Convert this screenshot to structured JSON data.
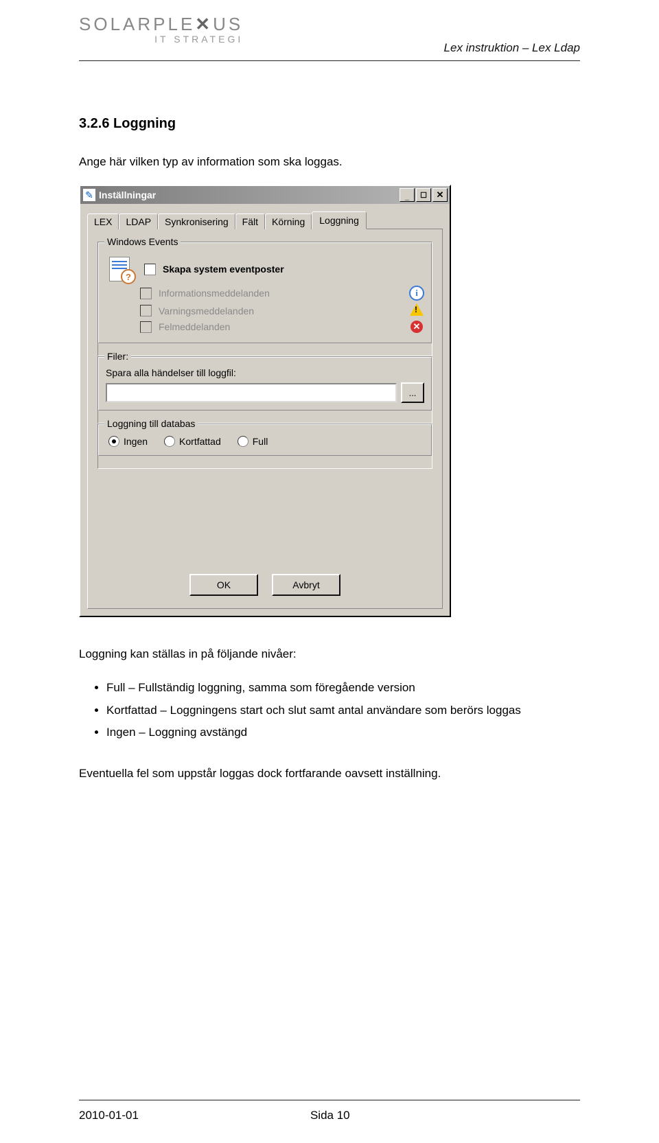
{
  "header": {
    "logo_main_a": "SOLARPLE",
    "logo_main_b": "US",
    "logo_sub": "IT STRATEGI",
    "doc_title": "Lex instruktion – Lex Ldap"
  },
  "section": {
    "heading": "3.2.6  Loggning",
    "intro": "Ange här vilken typ av information som ska loggas.",
    "after": "Loggning kan ställas in på följande nivåer:",
    "bullets": [
      "Full – Fullständig loggning, samma som föregående version",
      "Kortfattad – Loggningens start och slut samt antal användare som berörs loggas",
      "Ingen – Loggning avstängd"
    ],
    "closing": "Eventuella fel som uppstår loggas dock fortfarande oavsett inställning."
  },
  "dialog": {
    "title": "Inställningar",
    "tabs": [
      "LEX",
      "LDAP",
      "Synkronisering",
      "Fält",
      "Körning",
      "Loggning"
    ],
    "active_tab": "Loggning",
    "group_events": {
      "legend": "Windows Events",
      "main_label": "Skapa system eventposter",
      "rows": [
        {
          "label": "Informationsmeddelanden"
        },
        {
          "label": "Varningsmeddelanden"
        },
        {
          "label": "Felmeddelanden"
        }
      ]
    },
    "group_files": {
      "legend": "Filer:",
      "sublabel": "Spara alla händelser till loggfil:",
      "value": "",
      "browse": "..."
    },
    "group_db": {
      "legend": "Loggning till databas",
      "options": [
        "Ingen",
        "Kortfattad",
        "Full"
      ],
      "selected": "Ingen"
    },
    "buttons": {
      "ok": "OK",
      "cancel": "Avbryt"
    }
  },
  "footer": {
    "date": "2010-01-01",
    "page": "Sida 10"
  }
}
